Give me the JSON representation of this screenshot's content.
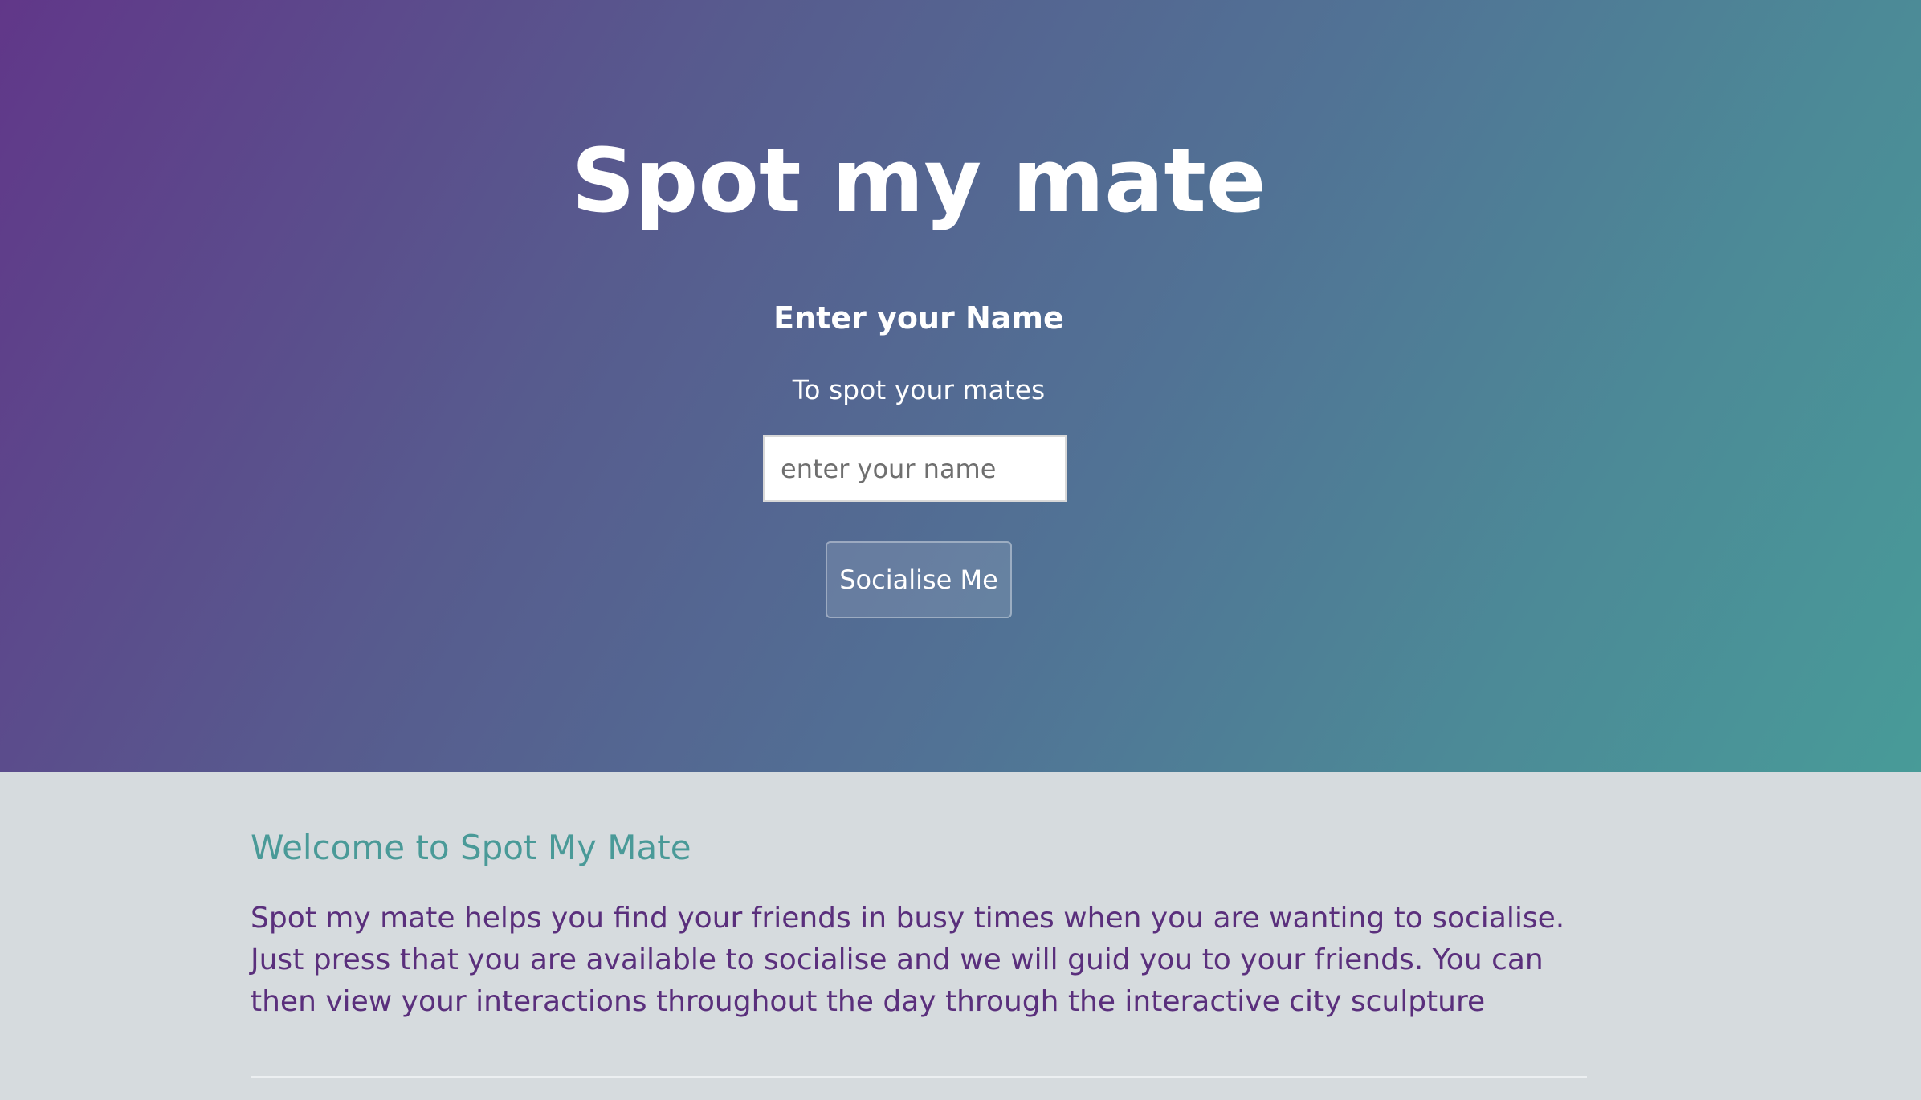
{
  "hero": {
    "title": "Spot my mate",
    "subtitle": "Enter your Name",
    "tagline": "To spot your mates",
    "name_input": {
      "value": "",
      "placeholder": "enter your name"
    },
    "submit_label": "Socialise Me"
  },
  "welcome": {
    "heading": "Welcome to Spot My Mate",
    "body": "Spot my mate helps you find your friends in busy times when you are wanting to socialise. Just press that you are available to socialise and we will guid you to your friends. You can then view your interactions throughout the day through the interactive city sculpture"
  },
  "colors": {
    "gradient_start": "#613789",
    "gradient_end": "#489b98",
    "section_bg": "#d6dbde",
    "heading_accent": "#4a9a98",
    "body_text": "#5a2f7c"
  }
}
